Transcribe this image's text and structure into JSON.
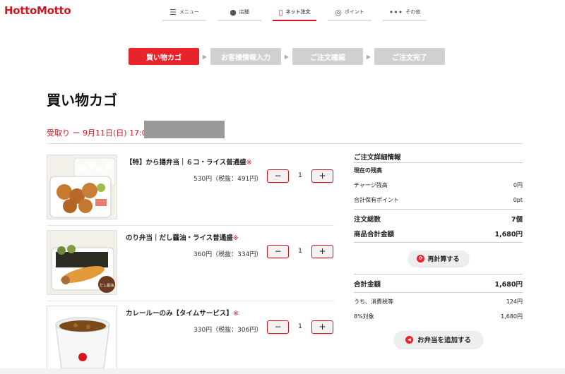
{
  "logo": "HottoMotto",
  "nav": [
    {
      "icon": "menu-icon",
      "glyph": "☰",
      "label": "メニュー"
    },
    {
      "icon": "pin-icon",
      "glyph": "●",
      "label": "店舗"
    },
    {
      "icon": "phone-icon",
      "glyph": "▯",
      "label": "ネット注文"
    },
    {
      "icon": "points-icon",
      "glyph": "◎",
      "label": "ポイント"
    },
    {
      "icon": "more-icon",
      "glyph": "•••",
      "label": "その他"
    }
  ],
  "steps": [
    "買い物カゴ",
    "お客様情報入力",
    "ご注文確認",
    "ご注文完了"
  ],
  "title": "買い物カゴ",
  "pickup": "受取り ー 9月11日(日) 17:00",
  "items": [
    {
      "name": "【特】から揚弁当｜６コ・ライス普通盛",
      "mark": "※",
      "price": "530円（税抜：491円）",
      "qty": "1",
      "minus": "−",
      "plus": "+"
    },
    {
      "name": "のり弁当｜だし醤油・ライス普通盛",
      "mark": "※",
      "price": "360円（税抜：334円）",
      "qty": "1",
      "minus": "−",
      "plus": "+"
    },
    {
      "name": "カレールーのみ【タイムサービス】",
      "mark": "※",
      "price": "330円（税抜：306円）",
      "qty": "1",
      "minus": "−",
      "plus": "+"
    }
  ],
  "summary": {
    "title": "ご注文詳細情報",
    "balance_label": "現在の残高",
    "charge_label": "チャージ残高",
    "charge_value": "0円",
    "points_label": "合計保有ポイント",
    "points_value": "0pt",
    "total_qty_label": "注文総数",
    "total_qty_value": "7個",
    "subtotal_label": "商品合計金額",
    "subtotal_value": "1,680円",
    "recalc": "再計算する",
    "total_label": "合計金額",
    "total_value": "1,680円",
    "tax_label": "うち、消費税等",
    "tax_value": "124円",
    "tax8_label": "8%対象",
    "tax8_value": "1,680円",
    "add_button": "お弁当を追加する"
  },
  "accent": "#d7141e"
}
